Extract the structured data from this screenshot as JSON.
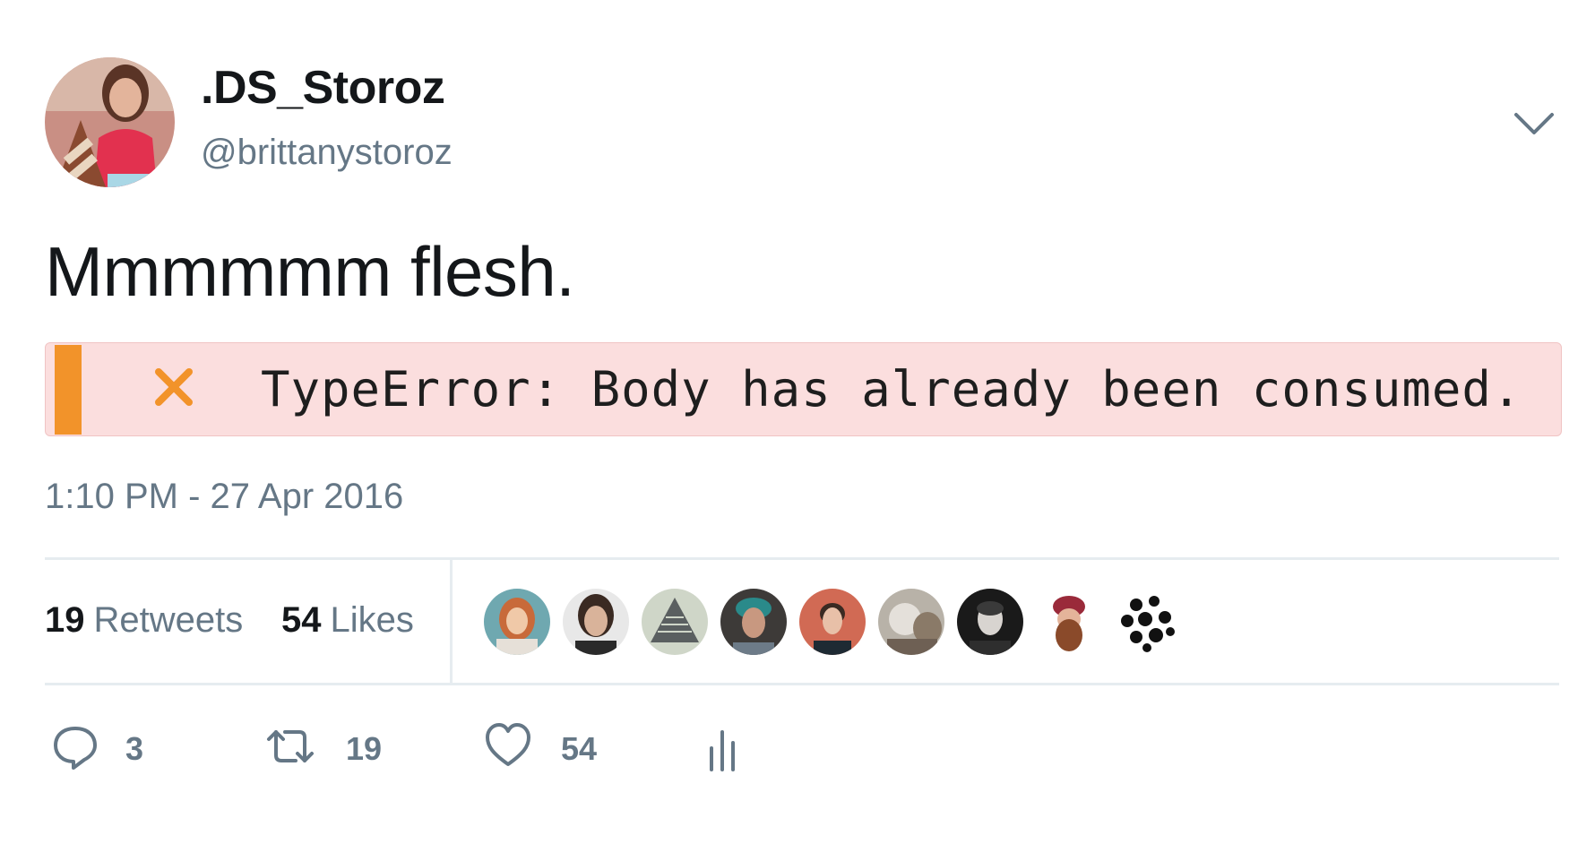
{
  "user": {
    "display_name": ".DS_Storoz",
    "handle": "@brittanystoroz"
  },
  "header": {
    "caret_icon": "chevron-down-icon"
  },
  "tweet": {
    "text": "Mmmmmm flesh.",
    "error_message": "TypeError: Body has already been consumed.",
    "error_icon": "close-x-icon",
    "timestamp": "1:10 PM - 27 Apr 2016"
  },
  "stats": {
    "retweets_count": "19",
    "retweets_label": "Retweets",
    "likes_count": "54",
    "likes_label": "Likes"
  },
  "likers": [
    {
      "name": "liker-avatar-1"
    },
    {
      "name": "liker-avatar-2"
    },
    {
      "name": "liker-avatar-3"
    },
    {
      "name": "liker-avatar-4"
    },
    {
      "name": "liker-avatar-5"
    },
    {
      "name": "liker-avatar-6"
    },
    {
      "name": "liker-avatar-7"
    },
    {
      "name": "liker-avatar-8"
    },
    {
      "name": "liker-avatar-9"
    }
  ],
  "actions": {
    "reply_count": "3",
    "retweet_count": "19",
    "like_count": "54"
  },
  "colors": {
    "text": "#14171a",
    "muted": "#657786",
    "error_bg": "#fbdede",
    "error_accent": "#f2932a",
    "divider": "#e6ecf0"
  }
}
